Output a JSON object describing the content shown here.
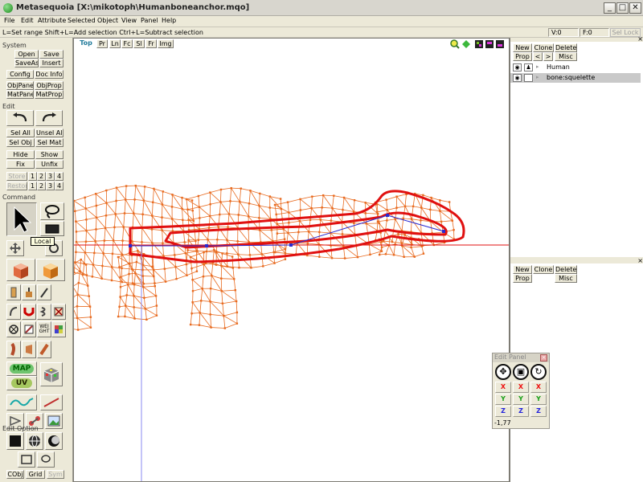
{
  "window": {
    "title": "Metasequoia [X:\\mikotoph\\Humanboneanchor.mqo]",
    "min": "_",
    "max": "□",
    "close": "✕"
  },
  "menu": [
    "File",
    "Edit",
    "Attribute",
    "Selected",
    "Object",
    "View",
    "Panel",
    "Help"
  ],
  "status": {
    "hint": "L=Set range  Shift+L=Add selection  Ctrl+L=Subtract selection",
    "v": "V:0",
    "f": "F:0",
    "sel_lock": "Sel Lock"
  },
  "left": {
    "system_title": "System",
    "open": "Open",
    "save": "Save",
    "saveas": "SaveAs",
    "insert": "Insert",
    "config": "Config",
    "docinfo": "Doc Info",
    "objpanel": "ObjPanel",
    "objprop": "ObjProp",
    "matpanel": "MatPanel",
    "matprop": "MatProp",
    "edit_title": "Edit",
    "selall": "Sel All",
    "unselall": "Unsel All",
    "selobj": "Sel Obj",
    "selmat": "Sel Mat",
    "hide": "Hide",
    "show": "Show",
    "fix": "Fix",
    "unfix": "Unfix",
    "store": "Store",
    "restore": "Restore",
    "slots": [
      "1",
      "2",
      "3",
      "4"
    ],
    "command_title": "Command",
    "tooltip": "Local",
    "map": "MAP",
    "uv": "UV",
    "weight": "WEI GHT",
    "editoption_title": "Edit Option",
    "cobj": "CObj",
    "grid": "Grid",
    "sym": "Sym"
  },
  "view": {
    "tabs": [
      "Top",
      "Pr",
      "Ln",
      "Fc",
      "Sl",
      "Fr",
      "Img"
    ],
    "accent": "#e86a1f",
    "highlight": "#e01010",
    "axis_color": "#8a8af0"
  },
  "object_panel": {
    "buttons": [
      "New",
      "Clone",
      "Delete",
      "Prop",
      "<",
      ">",
      "Misc"
    ],
    "objects": [
      {
        "name": "Human"
      },
      {
        "name": "bone:squelette"
      }
    ],
    "eye_icon": "eye-icon",
    "lock_icon": "lock-icon"
  },
  "material_panel": {
    "buttons": [
      "New",
      "Clone",
      "Delete",
      "Prop",
      "Misc"
    ]
  },
  "edit_panel": {
    "title": "Edit Panel",
    "axes": [
      "X",
      "Y",
      "Z"
    ],
    "value": "-1,77"
  }
}
